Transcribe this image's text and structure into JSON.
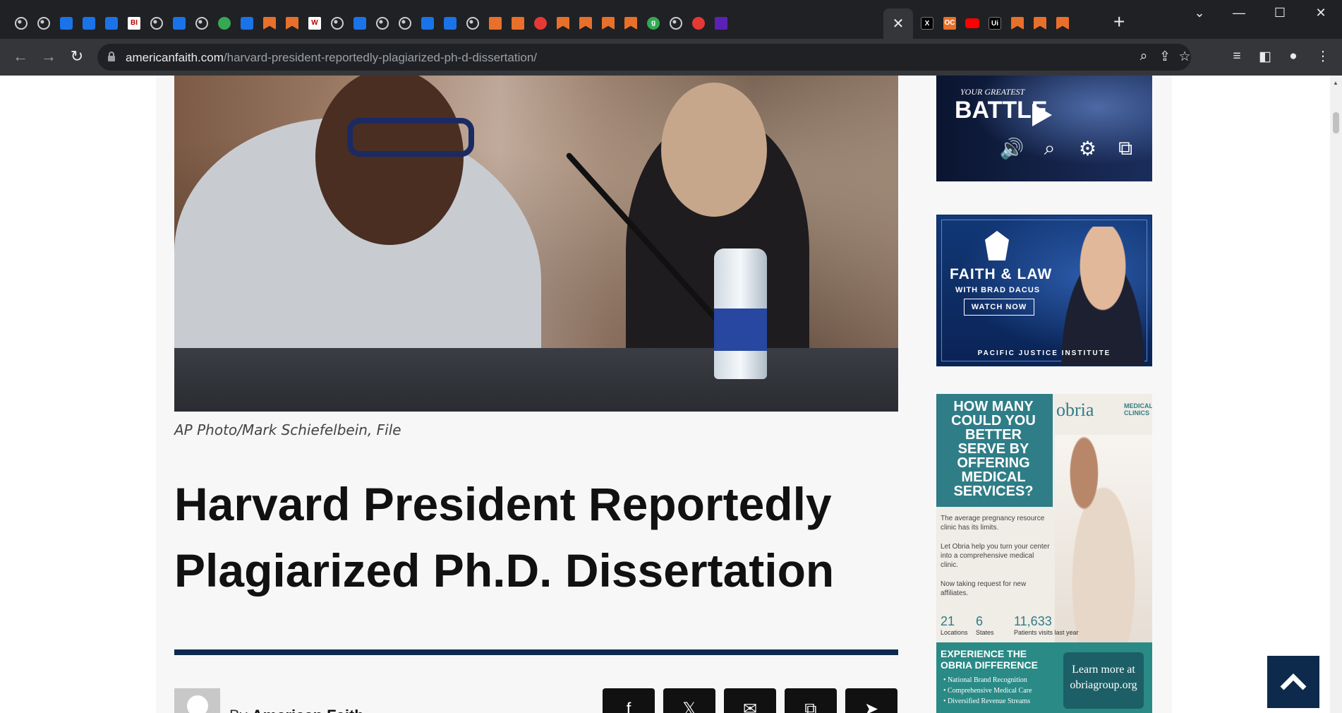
{
  "browser": {
    "tab_favicons": [
      "globe",
      "globe",
      "heart-blue",
      "heart-blue",
      "arrow-blue",
      "bi",
      "globe",
      "search",
      "globe",
      "play-green",
      "search",
      "bookmark-orange",
      "bookmark-orange",
      "wiki",
      "globe",
      "heart-blue",
      "globe",
      "globe",
      "cube-blue",
      "cube-blue",
      "globe",
      "shield-orange",
      "shield-orange",
      "pin-red",
      "bookmark-orange",
      "bookmark-orange",
      "bookmark-orange",
      "bookmark-orange",
      "g-green",
      "globe",
      "pin-red",
      "mail-purple"
    ],
    "tab_favicons_after": [
      "x-logo",
      "oc-orange",
      "youtube",
      "ui-dark",
      "bookmark-orange",
      "bookmark-orange",
      "bookmark-orange"
    ],
    "bi_label": "BI",
    "wiki_label": "W",
    "g_label": "g",
    "oc_label": "OC",
    "ui_label": "Ui",
    "x_label": "X",
    "active_tab_close": "✕",
    "new_tab": "+",
    "window_controls": {
      "tab_search": "⌄",
      "minimize": "—",
      "maximize": "☐",
      "close": "✕"
    },
    "nav": {
      "back": "←",
      "forward": "→",
      "reload": "↻"
    },
    "url_host": "americanfaith.com",
    "url_path": "/harvard-president-reportedly-plagiarized-ph-d-dissertation/",
    "toolbar_icons": {
      "zoom": "⌕",
      "share": "⇪",
      "bookmark": "☆",
      "media": "≡",
      "side_panel": "◧",
      "profile": "●",
      "menu": "⋮"
    }
  },
  "article": {
    "photo_credit": "AP Photo/Mark Schiefelbein, File",
    "headline": "Harvard President Reportedly Plagiarized Ph.D. Dissertation",
    "byline_prefix": "By ",
    "author": "American Faith",
    "share_buttons": [
      {
        "name": "facebook",
        "glyph": "f"
      },
      {
        "name": "x",
        "glyph": "𝕏"
      },
      {
        "name": "email",
        "glyph": "✉"
      },
      {
        "name": "copy",
        "glyph": "⧉"
      },
      {
        "name": "telegram",
        "glyph": "➤"
      }
    ]
  },
  "sidebar": {
    "video_ad": {
      "line1": "YOUR GREATEST",
      "line2": "BATTLE",
      "controls": [
        "🔊",
        "⌕",
        "⚙",
        "⧉"
      ]
    },
    "faith_ad": {
      "title": "FAITH & LAW",
      "subtitle": "WITH BRAD DACUS",
      "button": "WATCH NOW",
      "org": "PACIFIC JUSTICE INSTITUTE"
    },
    "obria_ad": {
      "headline": "HOW MANY COULD YOU BETTER SERVE BY OFFERING MEDICAL SERVICES?",
      "logo": "obria",
      "logo_sub": "MEDICAL CLINICS",
      "para1": "The average pregnancy resource clinic has its limits.",
      "para2": "Let Obria help you turn your center into a comprehensive medical clinic.",
      "para3": "Now taking request for new affiliates.",
      "stats": [
        {
          "value": "21",
          "label": "Locations"
        },
        {
          "value": "6",
          "label": "States"
        },
        {
          "value": "11,633",
          "label": "Patients visits last year"
        }
      ],
      "band_title": "EXPERIENCE THE OBRIA DIFFERENCE",
      "band_items": [
        "National Brand Recognition",
        "Comprehensive Medical Care",
        "Diversified Revenue Streams"
      ],
      "cta": "Learn more at obriagroup.org"
    }
  },
  "back_to_top_icon": "chevron-up-icon"
}
